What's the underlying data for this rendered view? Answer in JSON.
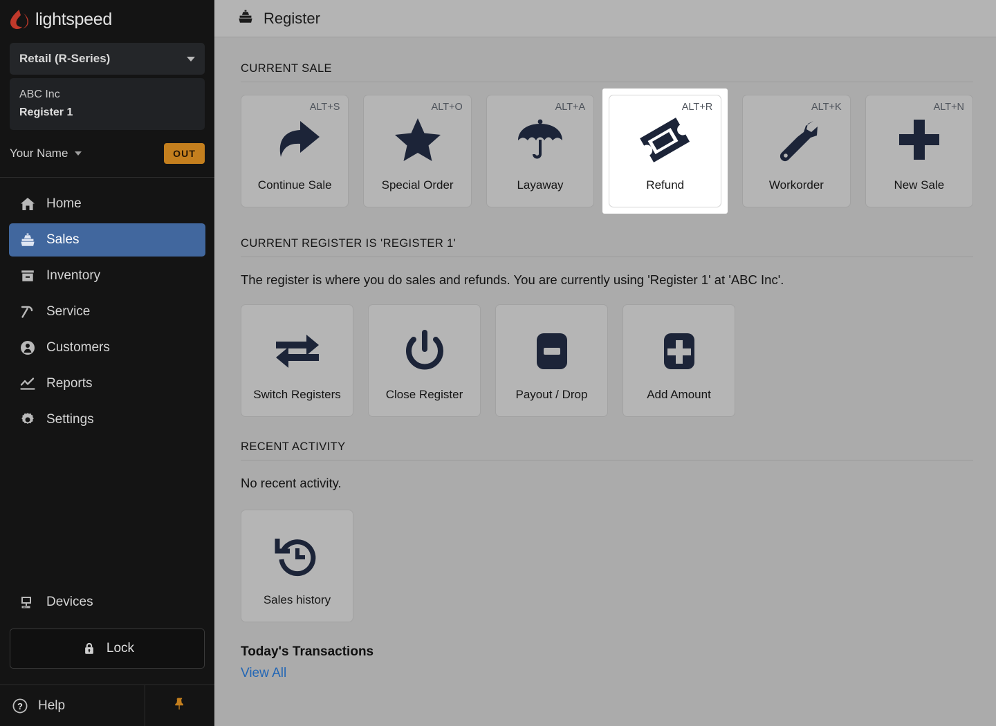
{
  "sidebar": {
    "brand": "lightspeed",
    "brand_logo_icon": "lightspeed-flame-icon",
    "brand_color": "#c0392b",
    "account_selector": {
      "label": "Retail (R-Series)",
      "caret_icon": "chevron-down-icon"
    },
    "shop": {
      "name": "ABC Inc",
      "register": "Register 1"
    },
    "user": {
      "name": "Your Name",
      "caret_icon": "chevron-down-icon",
      "status_badge": "OUT",
      "status_badge_color": "#c47f1e"
    },
    "nav_items": [
      {
        "label": "Home",
        "icon": "home-icon",
        "active": false
      },
      {
        "label": "Sales",
        "icon": "register-icon",
        "active": true
      },
      {
        "label": "Inventory",
        "icon": "box-icon",
        "active": false
      },
      {
        "label": "Service",
        "icon": "hammer-icon",
        "active": false
      },
      {
        "label": "Customers",
        "icon": "person-icon",
        "active": false
      },
      {
        "label": "Reports",
        "icon": "chart-line-icon",
        "active": false
      },
      {
        "label": "Settings",
        "icon": "gear-icon",
        "active": false
      }
    ],
    "active_color": "#41679e",
    "devices": {
      "label": "Devices",
      "icon": "desktop-icon"
    },
    "lock": {
      "label": "Lock",
      "icon": "lock-icon"
    },
    "help": {
      "label": "Help",
      "icon": "question-circle-icon"
    },
    "pin": {
      "icon": "pushpin-icon",
      "color": "#c47f1e"
    }
  },
  "topbar": {
    "title": "Register",
    "icon": "register-icon"
  },
  "current_sale": {
    "heading": "CURRENT SALE",
    "tiles": [
      {
        "label": "Continue Sale",
        "shortcut": "ALT+S",
        "icon": "arrow-forward-icon",
        "focused": false
      },
      {
        "label": "Special Order",
        "shortcut": "ALT+O",
        "icon": "star-icon",
        "focused": false
      },
      {
        "label": "Layaway",
        "shortcut": "ALT+A",
        "icon": "umbrella-icon",
        "focused": false
      },
      {
        "label": "Refund",
        "shortcut": "ALT+R",
        "icon": "ticket-icon",
        "focused": true
      },
      {
        "label": "Workorder",
        "shortcut": "ALT+K",
        "icon": "wrench-icon",
        "focused": false
      },
      {
        "label": "New Sale",
        "shortcut": "ALT+N",
        "icon": "plus-icon",
        "focused": false
      }
    ]
  },
  "current_register": {
    "heading": "CURRENT REGISTER IS 'REGISTER 1'",
    "description": "The register is where you do sales and refunds. You are currently using 'Register 1'  at 'ABC Inc'.",
    "tiles": [
      {
        "label": "Switch Registers",
        "icon": "swap-arrows-icon"
      },
      {
        "label": "Close Register",
        "icon": "power-icon"
      },
      {
        "label": "Payout / Drop",
        "icon": "minus-square-icon"
      },
      {
        "label": "Add Amount",
        "icon": "plus-square-icon"
      }
    ]
  },
  "recent_activity": {
    "heading": "RECENT ACTIVITY",
    "empty_message": "No recent activity.",
    "tiles": [
      {
        "label": "Sales history",
        "icon": "history-clock-icon"
      }
    ],
    "today_title": "Today's Transactions",
    "view_all_label": "View All",
    "link_color": "#2266b5"
  }
}
